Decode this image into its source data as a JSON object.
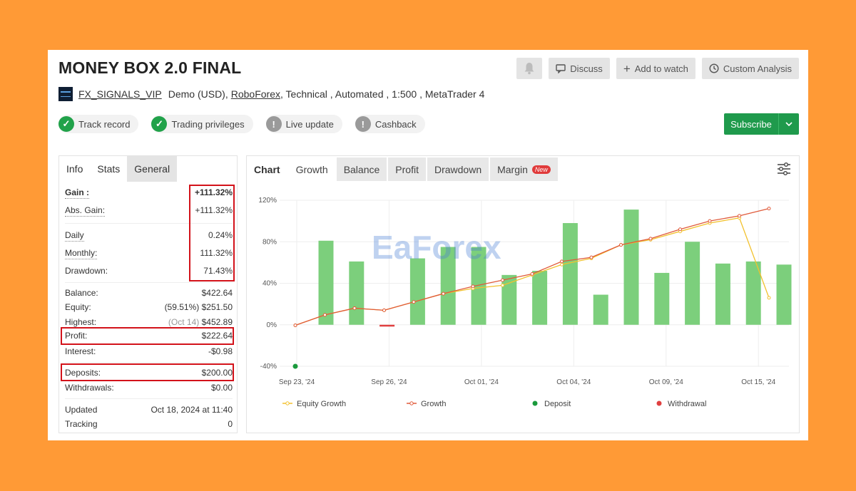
{
  "header": {
    "title": "MONEY BOX 2.0 FINAL",
    "discuss_label": "Discuss",
    "add_watch_label": "Add to watch",
    "custom_analysis_label": "Custom Analysis"
  },
  "subtitle": {
    "user": "FX_SIGNALS_VIP",
    "account": "Demo (USD),",
    "broker": "RoboForex",
    "details": ", Technical , Automated , 1:500 , MetaTrader 4"
  },
  "badges": [
    {
      "label": "Track record",
      "status": "ok"
    },
    {
      "label": "Trading privileges",
      "status": "ok"
    },
    {
      "label": "Live update",
      "status": "no"
    },
    {
      "label": "Cashback",
      "status": "no"
    }
  ],
  "subscribe_label": "Subscribe",
  "left_tabs": [
    "Info",
    "Stats",
    "General"
  ],
  "stats": {
    "gain_label": "Gain :",
    "gain": "+111.32%",
    "abs_gain_label": "Abs. Gain:",
    "abs_gain": "+111.32%",
    "daily_label": "Daily",
    "daily": "0.24%",
    "monthly_label": "Monthly:",
    "monthly": "111.32%",
    "drawdown_label": "Drawdown:",
    "drawdown": "71.43%",
    "balance_label": "Balance:",
    "balance": "$422.64",
    "equity_label": "Equity:",
    "equity_pct": "(59.51%)",
    "equity": "$251.50",
    "highest_label": "Highest:",
    "highest_date": "(Oct 14)",
    "highest": "$452.89",
    "profit_label": "Profit:",
    "profit": "$222.64",
    "interest_label": "Interest:",
    "interest": "-$0.98",
    "deposits_label": "Deposits:",
    "deposits": "$200.00",
    "withdrawals_label": "Withdrawals:",
    "withdrawals": "$0.00",
    "updated_label": "Updated",
    "updated": "Oct 18, 2024 at 11:40",
    "tracking_label": "Tracking",
    "tracking": "0"
  },
  "chart_tabs": {
    "chart": "Chart",
    "growth": "Growth",
    "balance": "Balance",
    "profit": "Profit",
    "drawdown": "Drawdown",
    "margin": "Margin",
    "new_badge": "New"
  },
  "watermark": "EaForex",
  "colors": {
    "accent_green": "#1f9a4c",
    "bar_green": "#7ccf7c",
    "growth_line": "#e05a3a",
    "equity_line": "#f2c12e",
    "withdrawal": "#e04040",
    "deposit": "#1a9a3c",
    "highlight_box": "#d3121a"
  },
  "chart_data": {
    "type": "bar",
    "x_labels": [
      "Sep 23, '24",
      "Sep 26, '24",
      "Oct 01, '24",
      "Oct 04, '24",
      "Oct 09, '24",
      "Oct 15, '24"
    ],
    "y_ticks": [
      "-40%",
      "0%",
      "40%",
      "80%",
      "120%"
    ],
    "ylim": [
      -40,
      120
    ],
    "bar_values": [
      81,
      61,
      -1.5,
      64,
      75,
      75,
      48,
      52,
      98,
      29,
      111,
      50,
      80,
      59,
      61,
      58
    ],
    "series": [
      {
        "name": "Equity Growth",
        "values": [
          -0.5,
          9.5,
          16,
          14,
          22,
          30,
          35,
          38,
          48,
          58,
          64,
          77,
          82,
          90,
          98,
          103,
          26
        ]
      },
      {
        "name": "Growth",
        "values": [
          -0.5,
          9.5,
          16,
          14,
          22,
          30,
          37,
          43,
          49,
          61,
          65,
          77,
          83,
          92,
          100,
          105,
          112
        ]
      },
      {
        "name": "Deposit",
        "values": [
          -40
        ]
      },
      {
        "name": "Withdrawal",
        "values": []
      }
    ]
  }
}
